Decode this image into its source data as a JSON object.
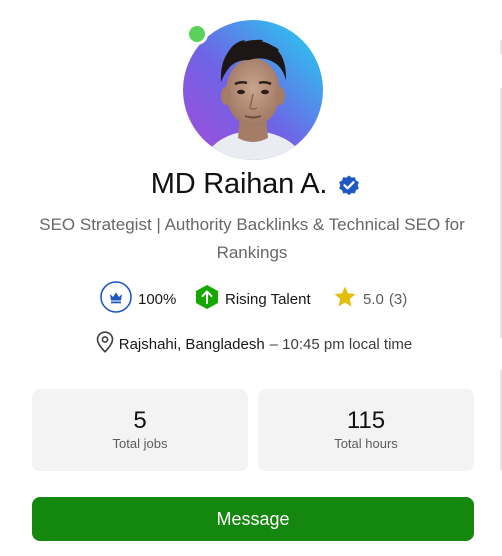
{
  "profile": {
    "name": "MD Raihan A.",
    "headline": "SEO Strategist | Authority Backlinks & Technical SEO for Rankings",
    "online_status_color": "#5ad15a"
  },
  "stats": {
    "job_success": "100%",
    "badge": "Rising Talent",
    "rating": "5.0",
    "reviews": "(3)"
  },
  "location": {
    "place": "Rajshahi, Bangladesh",
    "local_time": "– 10:45 pm local time"
  },
  "cards": [
    {
      "value": "5",
      "label": "Total jobs"
    },
    {
      "value": "115",
      "label": "Total hours"
    }
  ],
  "actions": {
    "message_label": "Message"
  },
  "colors": {
    "brand_green": "#14870e",
    "verified_blue": "#1f57c3",
    "star_yellow": "#e4be0c",
    "card_bg": "#f3f3f3"
  },
  "icons": {
    "verified": "verified-badge-icon",
    "job_success": "crown-icon",
    "rising_talent": "arrow-up-icon",
    "rating": "star-icon",
    "location": "map-pin-icon"
  }
}
